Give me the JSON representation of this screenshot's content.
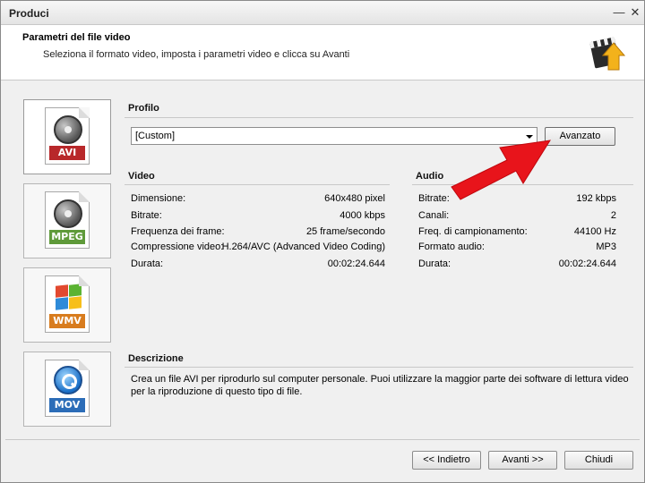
{
  "window": {
    "title": "Produci"
  },
  "header": {
    "title": "Parametri del file video",
    "subtitle": "Seleziona il formato video, imposta i parametri video e clicca su Avanti"
  },
  "formats": [
    {
      "label": "AVI",
      "color": "#b8282a",
      "selected": true
    },
    {
      "label": "MPEG",
      "color": "#5f9a3a",
      "selected": false
    },
    {
      "label": "WMV",
      "color": "#d87c1e",
      "selected": false
    },
    {
      "label": "MOV",
      "color": "#2c6db8",
      "selected": false
    }
  ],
  "profile": {
    "section": "Profilo",
    "value": "[Custom]",
    "advanced_button": "Avanzato"
  },
  "video": {
    "section": "Video",
    "rows": [
      {
        "key": "Dimensione:",
        "value": "640x480 pixel"
      },
      {
        "key": "Bitrate:",
        "value": "4000 kbps"
      },
      {
        "key": "Frequenza dei frame:",
        "value": "25 frame/secondo"
      },
      {
        "key": "Compressione video:",
        "value": "H.264/AVC (Advanced Video Coding)"
      },
      {
        "key": "Durata:",
        "value": "00:02:24.644"
      }
    ]
  },
  "audio": {
    "section": "Audio",
    "rows": [
      {
        "key": "Bitrate:",
        "value": "192 kbps"
      },
      {
        "key": "Canali:",
        "value": "2"
      },
      {
        "key": "Freq. di campionamento:",
        "value": "44100 Hz"
      },
      {
        "key": "Formato audio:",
        "value": "MP3"
      },
      {
        "key": "Durata:",
        "value": "00:02:24.644"
      }
    ]
  },
  "description": {
    "section": "Descrizione",
    "text": "Crea un file AVI per riprodurlo sul computer personale. Puoi utilizzare la maggior parte dei software di lettura video per la riproduzione di questo tipo di file."
  },
  "footer": {
    "back": "<< Indietro",
    "next": "Avanti >>",
    "close": "Chiudi"
  },
  "colors": {
    "annotation_arrow": "#e8141b"
  }
}
